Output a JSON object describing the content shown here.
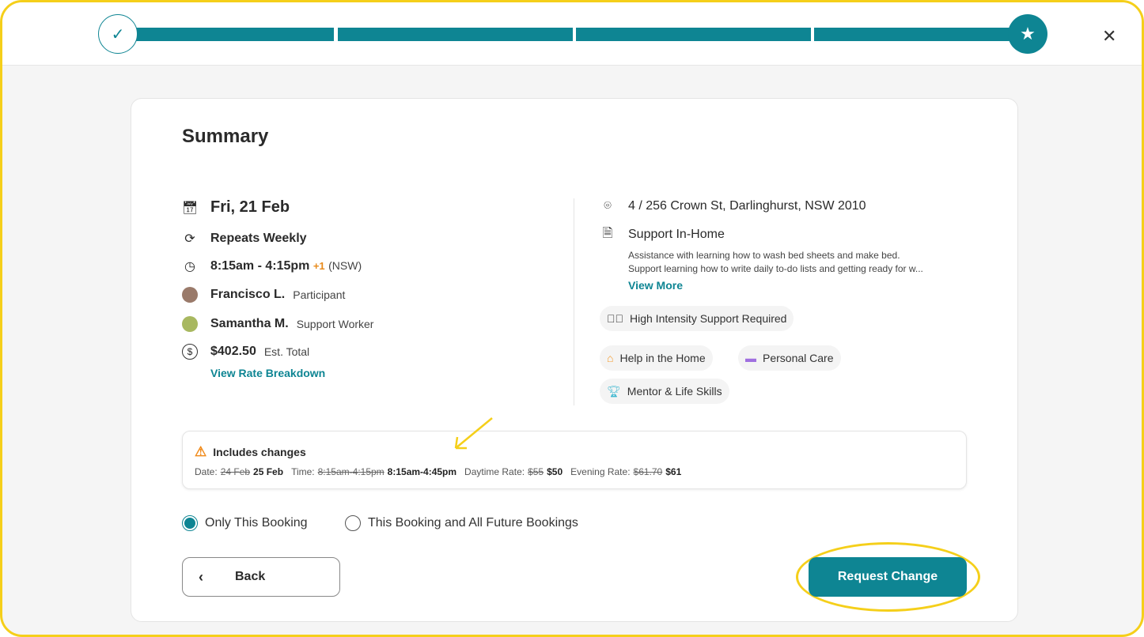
{
  "progress": {
    "steps_total": 5,
    "steps_completed": 5
  },
  "summary": {
    "title": "Summary",
    "date": "Fri, 21 Feb",
    "repeat": "Repeats Weekly",
    "time": "8:15am - 4:15pm",
    "time_plus": "+1",
    "timezone": "(NSW)",
    "participant": {
      "name": "Francisco L.",
      "role": "Participant"
    },
    "worker": {
      "name": "Samantha M.",
      "role": "Support Worker"
    },
    "total": "$402.50",
    "total_label": "Est. Total",
    "rate_link": "View Rate Breakdown",
    "address": "4 / 256 Crown St, Darlinghurst, NSW 2010",
    "service": "Support In-Home",
    "desc1": "Assistance with learning how to wash bed sheets and make bed.",
    "desc2": "Support learning how to write daily to-do lists and getting ready for w...",
    "view_more": "View More",
    "high_intensity": "High Intensity Support Required",
    "tags": [
      "Help in the Home",
      "Personal Care",
      "Mentor & Life Skills"
    ]
  },
  "changes": {
    "title": "Includes changes",
    "date_label": "Date:",
    "date_old": "24 Feb",
    "date_new": "25 Feb",
    "time_label": "Time:",
    "time_old": "8:15am-4:15pm",
    "time_new": "8:15am-4:45pm",
    "day_label": "Daytime Rate:",
    "day_old": "$55",
    "day_new": "$50",
    "eve_label": "Evening Rate:",
    "eve_old": "$61.70",
    "eve_new": "$61"
  },
  "options": {
    "only": "Only This Booking",
    "all": "This Booking and All Future Bookings",
    "selected": "only"
  },
  "buttons": {
    "back": "Back",
    "request": "Request Change"
  }
}
